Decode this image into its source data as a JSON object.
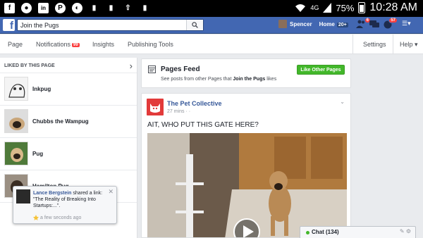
{
  "status_bar": {
    "left_icons": [
      "facebook-icon",
      "media-icon",
      "linkedin-icon",
      "pinterest-icon",
      "media-icon",
      "media-icon",
      "media-icon",
      "upload-icon",
      "media-icon"
    ],
    "network": "4G",
    "battery": "75%",
    "time": "10:28 AM"
  },
  "header": {
    "logo": "f",
    "search_value": "Join the Pugs",
    "user_name": "Spencer",
    "home_label": "Home",
    "home_count": "20+",
    "friend_requests_badge": "6",
    "notifications_badge": "57"
  },
  "page_nav": {
    "page": "Page",
    "notifications": "Notifications",
    "notifications_badge": "99",
    "insights": "Insights",
    "publishing_tools": "Publishing Tools",
    "settings": "Settings",
    "help": "Help ▾"
  },
  "liked": {
    "title": "LIKED BY THIS PAGE",
    "items": [
      {
        "name": "Inkpug"
      },
      {
        "name": "Chubbs the Wampug"
      },
      {
        "name": "Pug"
      },
      {
        "name": "Hamilton Pug"
      }
    ]
  },
  "pages_feed": {
    "title": "Pages Feed",
    "subtitle_prefix": "See posts from other Pages that ",
    "subtitle_page": "Join the Pugs",
    "subtitle_suffix": " likes",
    "button": "Like Other Pages"
  },
  "post": {
    "author": "The Pet Collective",
    "time": "27 mins · ·",
    "text": "AIT, WHO PUT THIS GATE HERE?"
  },
  "notification": {
    "author": "Lance Bergstein",
    "text": " shared a link: \"The Reality of Breaking Into Startups:...\".",
    "time": "a few seconds ago",
    "close": "✕"
  },
  "chat": {
    "label": "Chat (134)"
  },
  "colors": {
    "fb_blue": "#4267b2",
    "badge_red": "#fa3e3e",
    "green": "#42b72a",
    "link": "#365899"
  }
}
